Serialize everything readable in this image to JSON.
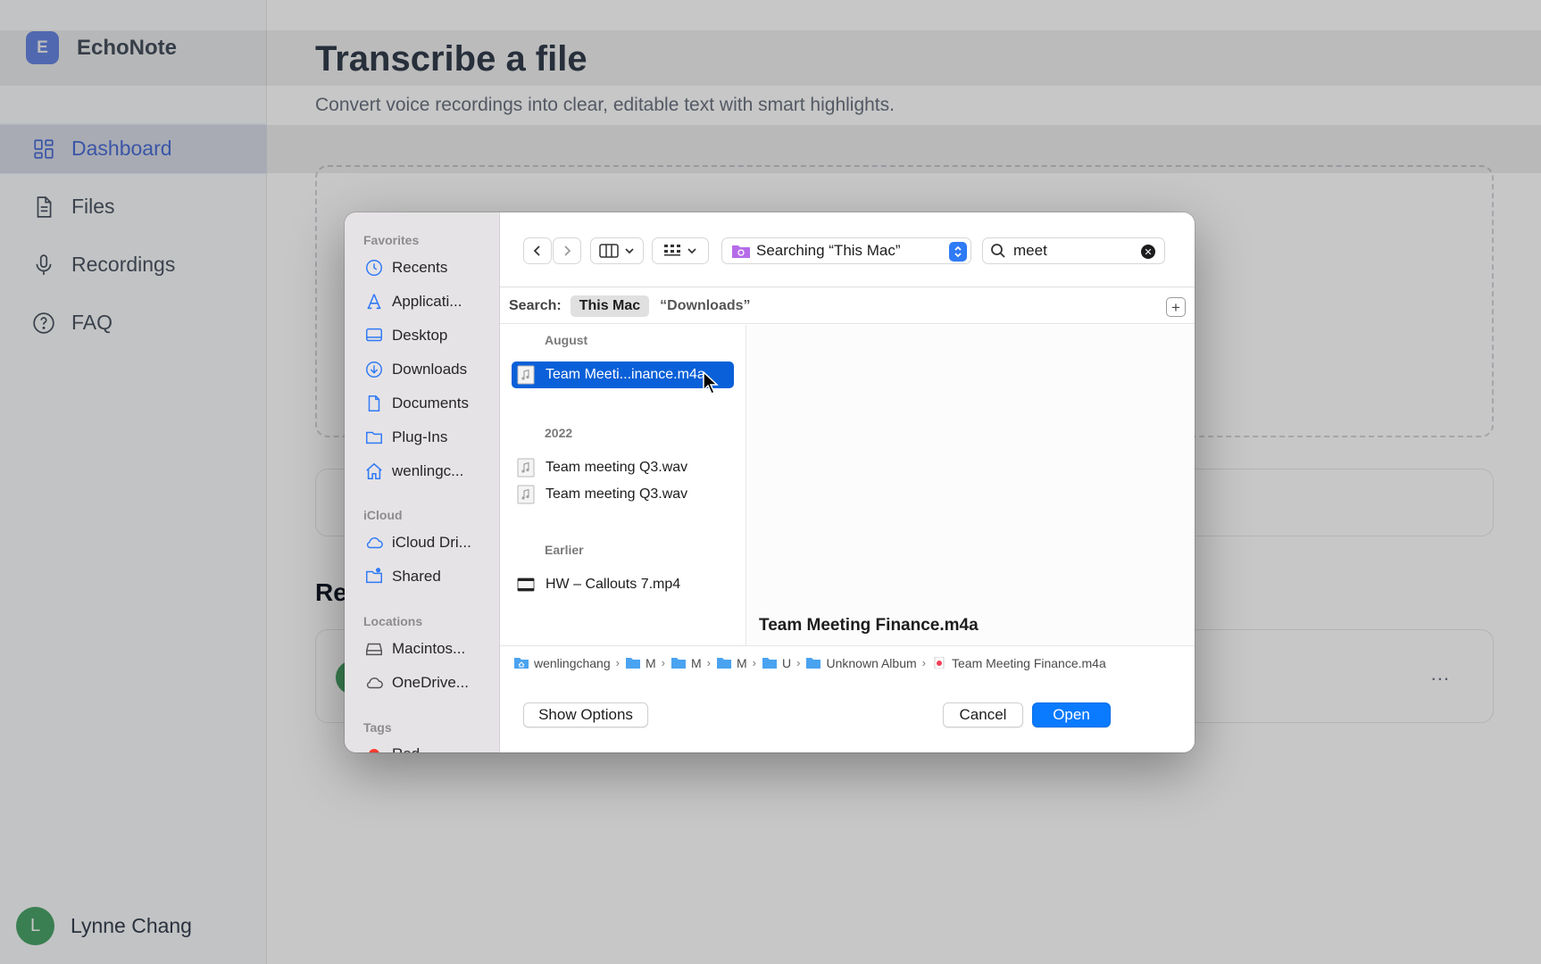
{
  "app": {
    "brand_initial": "E",
    "brand_name": "EchoNote",
    "nav": [
      {
        "label": "Dashboard",
        "icon": "dashboard-icon",
        "active": true
      },
      {
        "label": "Files",
        "icon": "file-icon"
      },
      {
        "label": "Recordings",
        "icon": "microphone-icon"
      },
      {
        "label": "FAQ",
        "icon": "help-circle-icon"
      }
    ],
    "user": {
      "initial": "L",
      "name": "Lynne Chang"
    },
    "page_title": "Transcribe a file",
    "page_subtitle": "Convert voice recordings into clear, editable text with smart highlights.",
    "recent_heading": "Re",
    "recent_more": "...",
    "colors": {
      "accent": "#5277e6",
      "avatar": "#4ba36a"
    }
  },
  "dialog": {
    "sidebar": {
      "favorites_label": "Favorites",
      "favorites": [
        {
          "label": "Recents",
          "icon": "clock-icon"
        },
        {
          "label": "Applicati...",
          "icon": "applications-icon"
        },
        {
          "label": "Desktop",
          "icon": "desktop-icon"
        },
        {
          "label": "Downloads",
          "icon": "download-icon"
        },
        {
          "label": "Documents",
          "icon": "document-icon"
        },
        {
          "label": "Plug-Ins",
          "icon": "folder-icon"
        },
        {
          "label": "wenlingc...",
          "icon": "home-icon"
        }
      ],
      "icloud_label": "iCloud",
      "icloud": [
        {
          "label": "iCloud Dri...",
          "icon": "cloud-icon"
        },
        {
          "label": "Shared",
          "icon": "shared-folder-icon"
        }
      ],
      "locations_label": "Locations",
      "locations": [
        {
          "label": "Macintos...",
          "icon": "disk-icon"
        },
        {
          "label": "OneDrive...",
          "icon": "cloud-icon"
        }
      ],
      "tags_label": "Tags",
      "tags": [
        {
          "label": "Red",
          "color": "#ff3b30"
        }
      ]
    },
    "toolbar": {
      "location": "Searching “This Mac”",
      "search_value": "meet"
    },
    "scope": {
      "label": "Search:",
      "active": "This Mac",
      "other": "“Downloads”",
      "add": "+"
    },
    "groups": [
      {
        "label": "August",
        "files": [
          {
            "name": "Team Meeti...inance.m4a",
            "type": "audio",
            "selected": true
          }
        ]
      },
      {
        "label": "2022",
        "files": [
          {
            "name": "Team meeting Q3.wav",
            "type": "audio"
          },
          {
            "name": "Team meeting Q3.wav",
            "type": "audio"
          }
        ]
      },
      {
        "label": "Earlier",
        "files": [
          {
            "name": "HW – Callouts 7.mp4",
            "type": "video"
          }
        ]
      }
    ],
    "preview_title": "Team Meeting Finance.m4a",
    "path": [
      "wenlingchang",
      "M",
      "M",
      "M",
      "U",
      "Unknown Album",
      "Team Meeting Finance.m4a"
    ],
    "buttons": {
      "options": "Show Options",
      "cancel": "Cancel",
      "open": "Open"
    },
    "colors": {
      "primary": "#0a7aff",
      "selection": "#0a60d8"
    }
  }
}
